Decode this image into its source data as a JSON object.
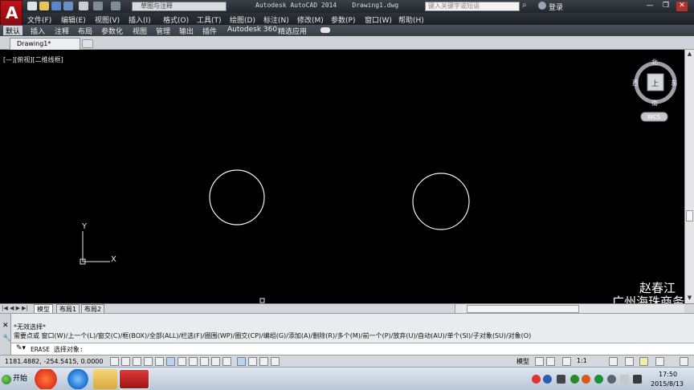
{
  "title_bar": {
    "workspace": "草图与注释",
    "title": "Autodesk AutoCAD 2014    Drawing1.dwg",
    "search_placeholder": "键入关键字或短语",
    "login_label": "登录",
    "minimize": "—",
    "restore": "❐",
    "close": "✕"
  },
  "menu": [
    "文件(F)",
    "编辑(E)",
    "视图(V)",
    "插入(I)",
    "格式(O)",
    "工具(T)",
    "绘图(D)",
    "标注(N)",
    "修改(M)",
    "参数(P)",
    "窗口(W)",
    "帮助(H)"
  ],
  "ribbon_tabs": [
    "默认",
    "插入",
    "注释",
    "布局",
    "参数化",
    "视图",
    "管理",
    "输出",
    "插件",
    "Autodesk 360",
    "精选应用"
  ],
  "document_tab": "Drawing1*",
  "viewport_label": "[—][俯视][二维线框]",
  "viewcube": {
    "north": "北",
    "south": "南",
    "east": "东",
    "west": "西",
    "top_face": "上",
    "wcs": "WCS"
  },
  "ucs": {
    "x": "X",
    "y": "Y"
  },
  "watermark": {
    "line1": "赵春江",
    "line2": "广州海珠商务"
  },
  "layout_tabs": [
    "模型",
    "布局1",
    "布局2"
  ],
  "command": {
    "line1": "*无效选择*",
    "line2": "需要点或 窗口(W)/上一个(L)/窗交(C)/框(BOX)/全部(ALL)/栏选(F)/圈围(WP)/圈交(CP)/编组(G)/添加(A)/删除(R)/多个(M)/前一个(P)/放弃(U)/自动(AU)/单个(SI)/子对象(SU)/对象(O)",
    "prompt": "ERASE 选择对象:"
  },
  "status": {
    "coords": "1181.4882, -254.5415, 0.0000",
    "model": "模型",
    "scale": "1:1"
  },
  "taskbar": {
    "start": "开始",
    "time": "17:50",
    "date": "2015/8/13"
  }
}
